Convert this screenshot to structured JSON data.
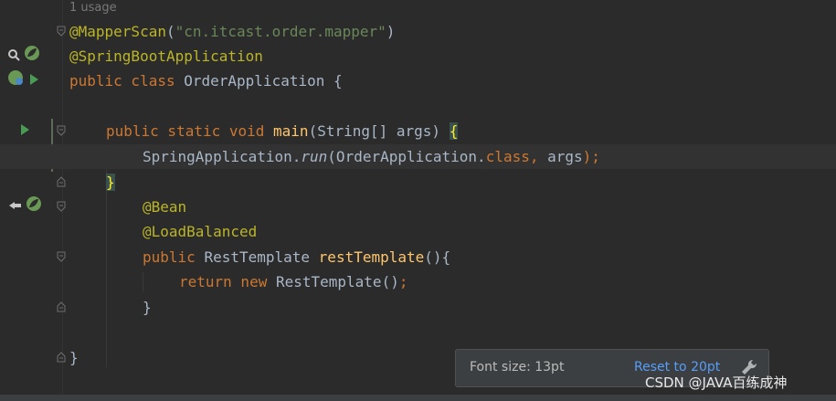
{
  "editor": {
    "usage_hint": "1 usage",
    "lines": {
      "l1": {
        "ann": "@MapperScan",
        "paren_open": "(",
        "str": "\"cn.itcast.order.mapper\"",
        "paren_close": ")"
      },
      "l2": {
        "ann": "@SpringBootApplication"
      },
      "l3": {
        "kw": "public class ",
        "name": "OrderApplication {"
      },
      "l5": {
        "kw": "public static void ",
        "fn": "main",
        "rest": "(String[] args) ",
        "brace": "{"
      },
      "l6": {
        "pre": "SpringApplication.",
        "method": "run",
        "mid": "(OrderApplication.",
        "kw": "class",
        "comma": ", ",
        "args": "args",
        "end": ");"
      },
      "l7": {
        "brace": "}"
      },
      "l8": {
        "ann": "@Bean"
      },
      "l9": {
        "ann": "@LoadBalanced"
      },
      "l10": {
        "kw": "public ",
        "type": "RestTemplate ",
        "fn": "restTemplate",
        "rest": "(){"
      },
      "l11": {
        "kw": "return new ",
        "rest": "RestTemplate()",
        "semi": ";"
      },
      "l12": {
        "brace": "}"
      },
      "l14": {
        "brace": "}"
      }
    }
  },
  "popup": {
    "font_size_text": "Font size: 13pt",
    "reset_link": "Reset to 20pt"
  },
  "watermark": "CSDN @JAVA百练成神",
  "icons": [
    "search-icon",
    "spring-bean-icon",
    "run-icon",
    "implement-icon"
  ],
  "colors": {
    "background": "#2b2b2b",
    "keyword": "#cc7832",
    "annotation": "#bbb529",
    "string": "#6a8759",
    "function": "#ffc66d",
    "text": "#a9b7c6",
    "link": "#589df6"
  }
}
